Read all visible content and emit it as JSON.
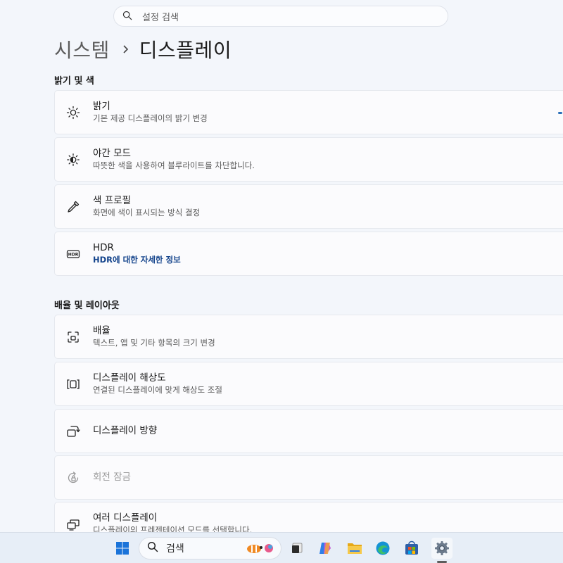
{
  "search": {
    "placeholder": "설정 검색"
  },
  "breadcrumb": {
    "parent": "시스템",
    "separator": "›",
    "current": "디스플레이"
  },
  "sections": {
    "brightness_color": {
      "title": "밝기 및 색"
    },
    "scale_layout": {
      "title": "배율 및 레이아웃"
    }
  },
  "cards": {
    "brightness": {
      "title": "밝기",
      "subtitle": "기본 제공 디스플레이의 밝기 변경",
      "icon": "brightness-icon"
    },
    "night_mode": {
      "title": "야간 모드",
      "subtitle": "따뜻한 색을 사용하여 블루라이트를 차단합니다.",
      "icon": "night-light-icon"
    },
    "color_profile": {
      "title": "색 프로필",
      "subtitle": "화면에 색이 표시되는 방식 결정",
      "icon": "eyedropper-icon"
    },
    "hdr": {
      "title": "HDR",
      "subtitle": "HDR에 대한 자세한 정보",
      "icon": "hdr-icon"
    },
    "scale": {
      "title": "배율",
      "subtitle": "텍스트, 앱 및 기타 항목의 크기 변경",
      "icon": "scale-icon"
    },
    "resolution": {
      "title": "디스플레이 해상도",
      "subtitle": "연결된 디스플레이에 맞게 해상도 조절",
      "icon": "resolution-icon"
    },
    "orientation": {
      "title": "디스플레이 방향",
      "icon": "orientation-icon"
    },
    "rotation_lock": {
      "title": "회전 잠금",
      "icon": "rotation-lock-icon",
      "disabled": true
    },
    "multiple_displays": {
      "title": "여러 디스플레이",
      "subtitle": "디스플레이의 프레젠테이션 모드를 선택합니다.",
      "icon": "multiple-displays-icon"
    }
  },
  "taskbar": {
    "search_label": "검색",
    "items": [
      "start-icon",
      "search-icon",
      "task-view-icon",
      "copilot-icon",
      "file-explorer-icon",
      "edge-icon",
      "store-icon",
      "settings-icon"
    ],
    "active_item": "settings-icon"
  },
  "colors": {
    "accent": "#2a6fb8",
    "link": "#14448c",
    "background": "#f3f6fb"
  }
}
